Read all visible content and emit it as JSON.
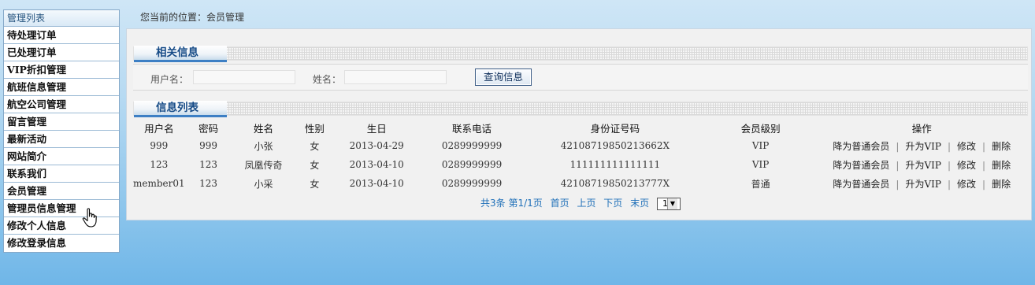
{
  "sidebar": {
    "header": "管理列表",
    "items": [
      {
        "label": "待处理订单"
      },
      {
        "label": "已处理订单"
      },
      {
        "label": "VIP折扣管理"
      },
      {
        "label": "航班信息管理"
      },
      {
        "label": "航空公司管理"
      },
      {
        "label": "留言管理"
      },
      {
        "label": "最新活动"
      },
      {
        "label": "网站简介"
      },
      {
        "label": "联系我们"
      },
      {
        "label": "会员管理"
      },
      {
        "label": "管理员信息管理"
      },
      {
        "label": "修改个人信息"
      },
      {
        "label": "修改登录信息"
      }
    ]
  },
  "breadcrumb": "您当前的位置：会员管理",
  "search_section": {
    "title": "相关信息",
    "username_label": "用户名：",
    "username_value": "",
    "name_label": "姓名：",
    "name_value": "",
    "query_button": "查询信息"
  },
  "list_section": {
    "title": "信息列表",
    "columns": [
      "用户名",
      "密码",
      "姓名",
      "性别",
      "生日",
      "联系电话",
      "身份证号码",
      "会员级别",
      "操作"
    ],
    "rows": [
      {
        "username": "999",
        "password": "999",
        "name": "小张",
        "gender": "女",
        "birthday": "2013-04-29",
        "phone": "0289999999",
        "id_number": "42108719850213662X",
        "level": "VIP"
      },
      {
        "username": "123",
        "password": "123",
        "name": "凤凰传奇",
        "gender": "女",
        "birthday": "2013-04-10",
        "phone": "0289999999",
        "id_number": "111111111111111",
        "level": "VIP"
      },
      {
        "username": "member01",
        "password": "123",
        "name": "小采",
        "gender": "女",
        "birthday": "2013-04-10",
        "phone": "0289999999",
        "id_number": "42108719850213777X",
        "level": "普通"
      }
    ],
    "actions": {
      "demote": "降为普通会员",
      "promote": "升为VIP",
      "edit": "修改",
      "delete": "删除",
      "separator": "|"
    }
  },
  "pager": {
    "summary": "共3条 第1/1页",
    "first": "首页",
    "prev": "上页",
    "next": "下页",
    "last": "末页",
    "page_select": "1"
  },
  "icons": {
    "cursor": "hand-pointer-icon",
    "dropdown": "chevron-down-icon"
  },
  "colors": {
    "accent": "#3d7fc4",
    "link": "#1e6fb8"
  }
}
